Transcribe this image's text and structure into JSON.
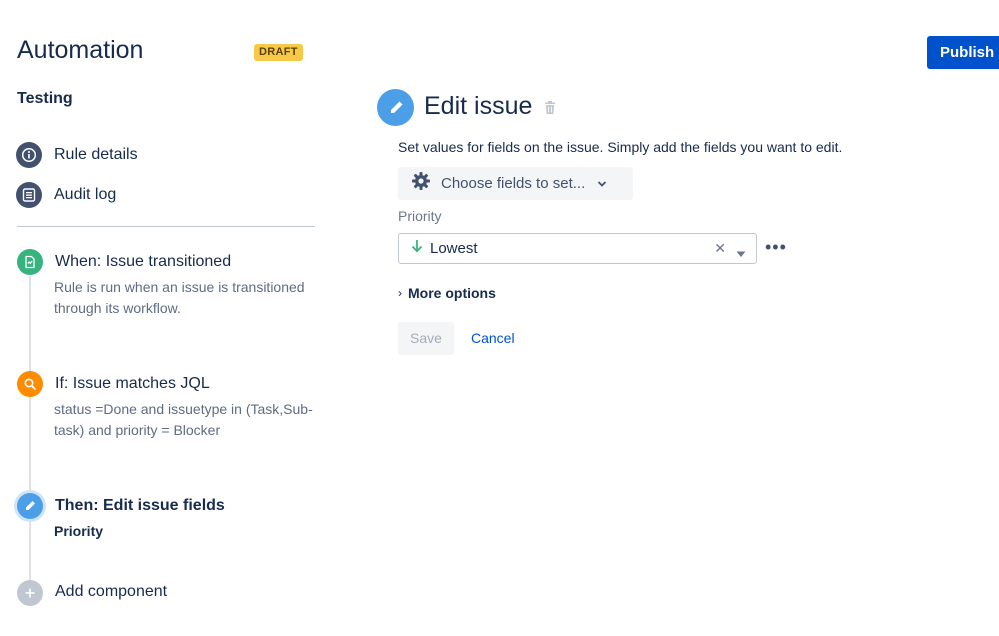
{
  "header": {
    "title": "Automation",
    "status_badge": "DRAFT",
    "publish_label": "Publish rule"
  },
  "rule": {
    "name": "Testing"
  },
  "nav": {
    "items": [
      {
        "label": "Rule details",
        "icon": "info-icon"
      },
      {
        "label": "Audit log",
        "icon": "list-icon"
      }
    ]
  },
  "timeline": {
    "steps": [
      {
        "title": "When: Issue transitioned",
        "description": "Rule is run when an issue is transitioned through its workflow.",
        "icon": "trigger-icon",
        "color": "#36b37e"
      },
      {
        "title": "If: Issue matches JQL",
        "description": "status =Done and issuetype in (Task,Sub-task) and priority = Blocker",
        "icon": "search-icon",
        "color": "#ff8b00"
      },
      {
        "title": "Then: Edit issue fields",
        "description": "Priority",
        "icon": "pencil-icon",
        "color": "#4c9fe6"
      }
    ],
    "add_component_label": "Add component"
  },
  "editor": {
    "title": "Edit issue",
    "description": "Set values for fields on the issue. Simply add the fields you want to edit.",
    "choose_fields_label": "Choose fields to set...",
    "priority_field_label": "Priority",
    "priority_value": "Lowest",
    "more_options_label": "More options",
    "save_label": "Save",
    "cancel_label": "Cancel"
  }
}
